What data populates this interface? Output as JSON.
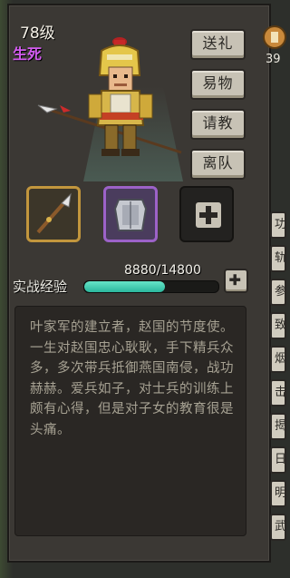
{
  "character": {
    "level": "78级",
    "status": "生死"
  },
  "actions": {
    "gift": "送礼",
    "trade": "易物",
    "consult": "请教",
    "leave_team": "离队"
  },
  "equipment": {
    "weapon": "spear-icon",
    "armor": "chestplate-icon",
    "empty_slot": "plus-icon"
  },
  "experience": {
    "label": "实战经验",
    "value_text": "8880/14800",
    "current": 8880,
    "max": 14800,
    "fill_fraction": 0.6
  },
  "description": "叶家军的建立者，赵国的节度使。一生对赵国忠心耿耿，手下精兵众多，多次带兵抵御燕国南侵，战功赫赫。爱兵如子，对士兵的训练上颇有心得，但是对子女的教育很是头痛。",
  "side_tabs": [
    "功",
    "轨",
    "参",
    "致",
    "烟",
    "击",
    "揭",
    "日",
    "明",
    "武"
  ],
  "currency": {
    "icon": "coin-icon",
    "amount": "39"
  },
  "colors": {
    "status_purple": "#d35cf0",
    "xp_bar": "#3cc4a8",
    "weapon_border": "#c2963d",
    "armor_border": "#9c62c8"
  }
}
